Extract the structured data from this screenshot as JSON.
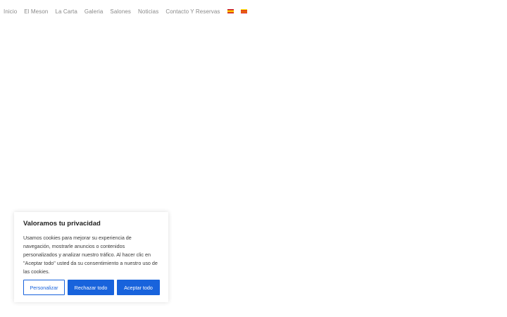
{
  "nav": {
    "items": [
      {
        "label": "Inicio"
      },
      {
        "label": "El Meson"
      },
      {
        "label": "La Carta"
      },
      {
        "label": "Galeria"
      },
      {
        "label": "Salones"
      },
      {
        "label": "Noticias"
      },
      {
        "label": "Contacto Y Reservas"
      }
    ],
    "flags": [
      "spanish-flag-icon",
      "catalan-flag-icon"
    ]
  },
  "cookie_banner": {
    "title": "Valoramos tu privacidad",
    "text": "Usamos cookies para mejorar su experiencia de navegación, mostrarle anuncios o contenidos personalizados y analizar nuestro tráfico. Al hacer clic en \"Aceptar todo\" usted da su consentimiento a nuestro uso de las cookies.",
    "customize_label": "Personalizar",
    "reject_label": "Rechazar todo",
    "accept_label": "Aceptar todo"
  },
  "colors": {
    "accent": "#1863dc",
    "nav_text": "#8a8a8a"
  }
}
